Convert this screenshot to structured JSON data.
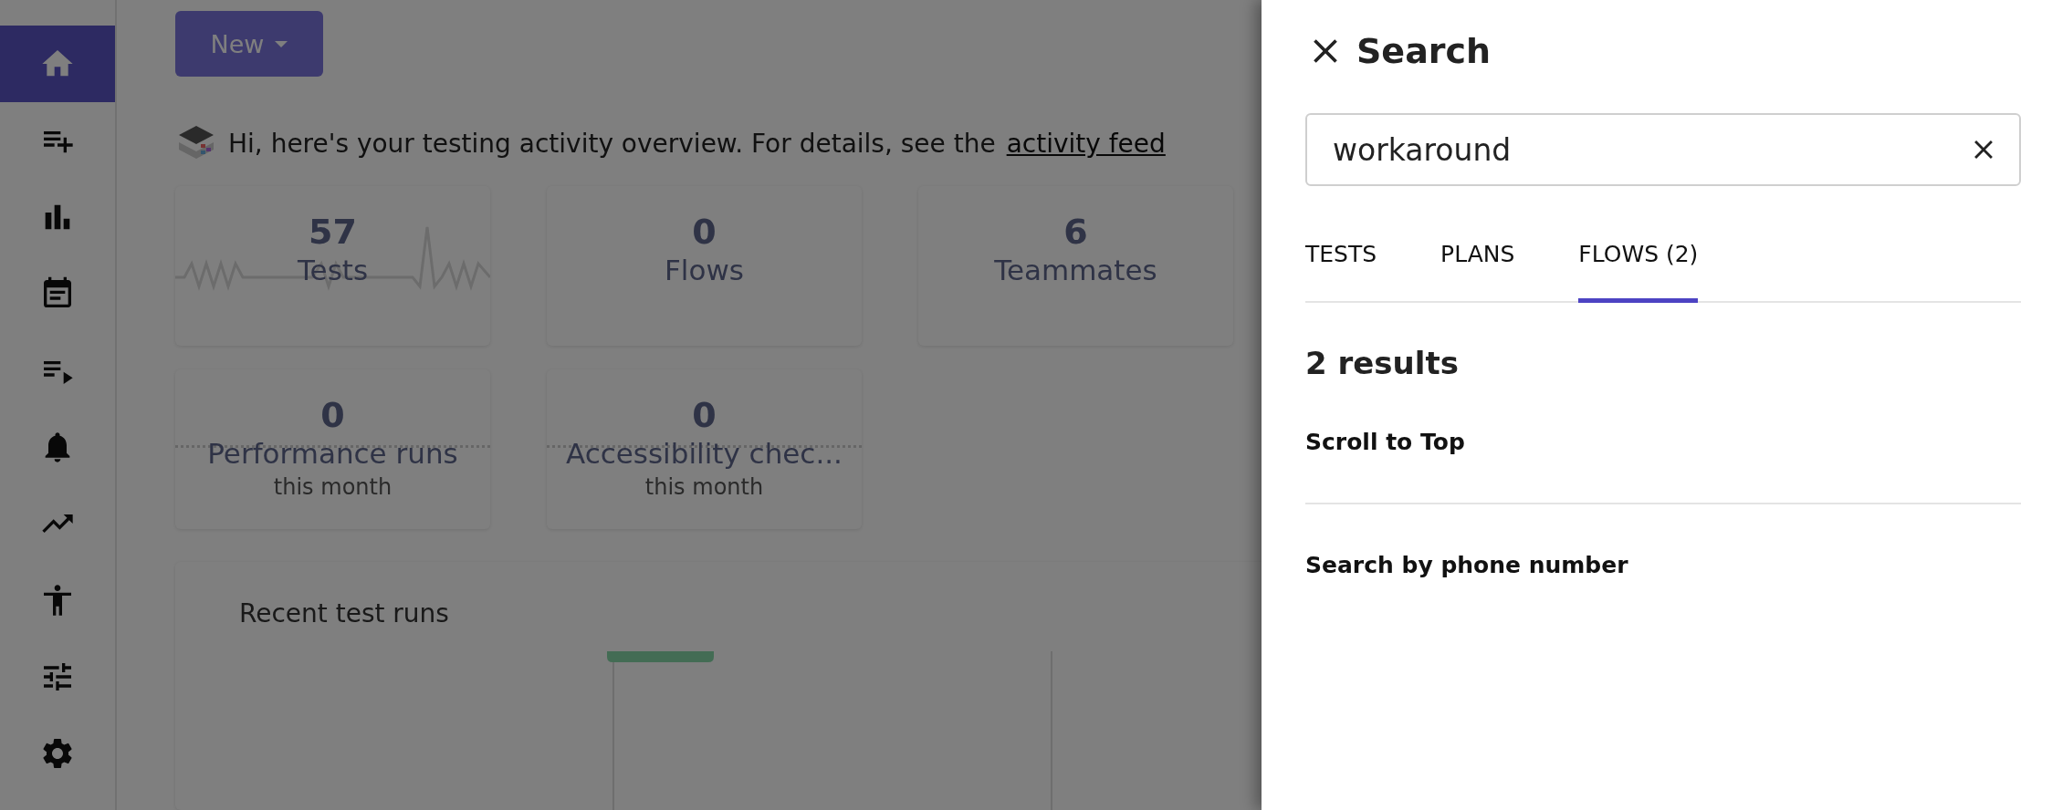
{
  "sidebar": {
    "items": [
      {
        "selected": true
      },
      {
        "selected": false
      },
      {
        "selected": false
      },
      {
        "selected": false
      },
      {
        "selected": false
      },
      {
        "selected": false
      },
      {
        "selected": false
      },
      {
        "selected": false
      },
      {
        "selected": false
      },
      {
        "selected": false
      }
    ]
  },
  "new_button": {
    "label": "New"
  },
  "greeting": {
    "text": "Hi, here's your testing activity overview. For details, see the",
    "link": "activity feed"
  },
  "stats": [
    {
      "value": "57",
      "label": "Tests"
    },
    {
      "value": "0",
      "label": "Flows"
    },
    {
      "value": "6",
      "label": "Teammates"
    },
    {
      "value": "0",
      "label": "Performance runs",
      "sublabel": "this month"
    },
    {
      "value": "0",
      "label": "Accessibility chec...",
      "sublabel": "this month"
    }
  ],
  "recent_runs": {
    "title": "Recent test runs"
  },
  "search_panel": {
    "title": "Search",
    "query": "workaround",
    "tabs": [
      {
        "label": "TESTS",
        "selected": false
      },
      {
        "label": "PLANS",
        "selected": false
      },
      {
        "label": "FLOWS (2)",
        "selected": true
      }
    ],
    "result_count": "2 results",
    "results": [
      "Scroll to Top",
      "Search by phone number"
    ]
  }
}
